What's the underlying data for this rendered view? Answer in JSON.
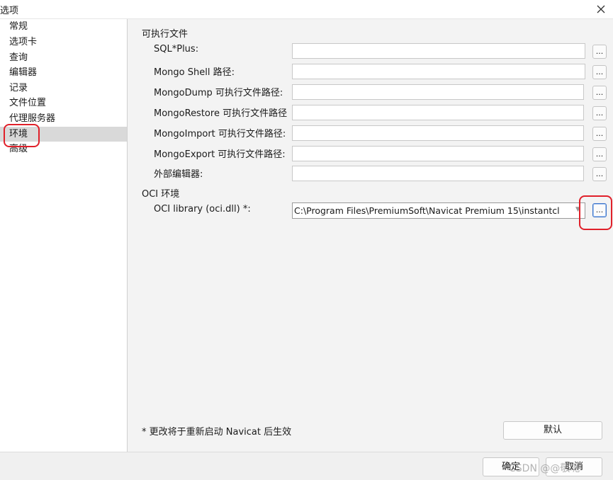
{
  "window": {
    "title": "选项",
    "close_icon": "close-icon"
  },
  "sidebar": {
    "items": [
      {
        "label": "常规"
      },
      {
        "label": "选项卡"
      },
      {
        "label": "查询"
      },
      {
        "label": "编辑器"
      },
      {
        "label": "记录"
      },
      {
        "label": "文件位置"
      },
      {
        "label": "代理服务器"
      },
      {
        "label": "环境"
      },
      {
        "label": "高级"
      }
    ],
    "selected": "环境"
  },
  "main": {
    "executables_section": "可执行文件",
    "rows": [
      {
        "label": "SQL*Plus:",
        "value": "",
        "browse": "..."
      },
      {
        "label": "Mongo Shell 路径:",
        "value": "",
        "browse": "..."
      },
      {
        "label": "MongoDump 可执行文件路径:",
        "value": "",
        "browse": "..."
      },
      {
        "label": "MongoRestore 可执行文件路径",
        "value": "",
        "browse": "..."
      },
      {
        "label": "MongoImport 可执行文件路径:",
        "value": "",
        "browse": "..."
      },
      {
        "label": "MongoExport 可执行文件路径:",
        "value": "",
        "browse": "..."
      },
      {
        "label": "外部编辑器:",
        "value": "",
        "browse": "..."
      }
    ],
    "oci_section": "OCI 环境",
    "oci": {
      "label": "OCI library (oci.dll) *:",
      "value": "C:\\Program Files\\PremiumSoft\\Navicat Premium 15\\instantcl",
      "browse": "..."
    },
    "note": "* 更改将于重新启动 Navicat 后生效",
    "default_button": "默认"
  },
  "footer": {
    "ok_button": "确定",
    "cancel_button": "取消",
    "watermark": "CSDN @@敬呢"
  },
  "colors": {
    "highlight": "#e0202a",
    "selected_bg": "#d9d9d9",
    "panel_bg": "#f3f3f3",
    "focus": "#3a73c9"
  }
}
